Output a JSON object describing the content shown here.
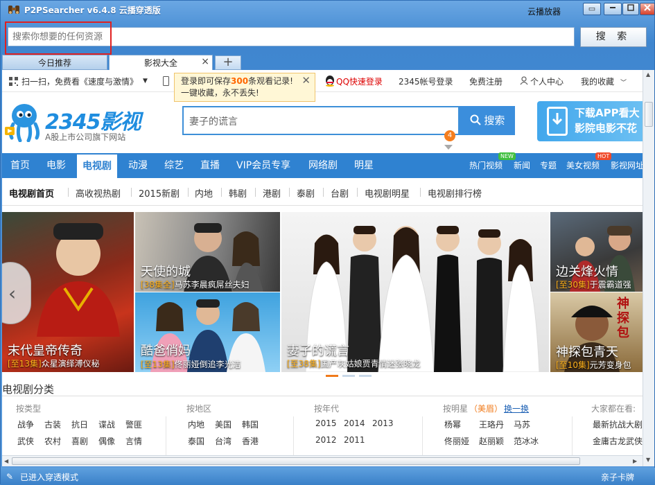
{
  "window": {
    "title": "P2PSearcher v6.4.8 云播穿透版",
    "subtitle": "云播放器",
    "min_label": "▭",
    "restore_label": "—",
    "max_label": "□",
    "close_label": "✕"
  },
  "search": {
    "placeholder": "搜索你想要的任何资源",
    "button_label": "搜 索"
  },
  "tabs": [
    {
      "label": "今日推荐",
      "active": false
    },
    {
      "label": "影视大全",
      "active": true
    }
  ],
  "tab_add_label": "+",
  "toplinks": {
    "scan": "扫一扫，免费看《速度与激情》",
    "qq_login": "QQ快速登录",
    "account_login": "2345帐号登录",
    "register": "免费注册",
    "personal": "个人中心",
    "favorites": "我的收藏"
  },
  "tooltip": {
    "line1_pre": "登录即可保存",
    "line1_num": "300",
    "line1_post": "条观看记录!",
    "line2": "一键收藏，永不丢失!"
  },
  "site": {
    "brand": "2345影视",
    "brand_sub": "A股上市公司旗下网站",
    "search_value": "妻子的谎言",
    "search_badge": "4",
    "search_button": "搜索",
    "app_banner_line1": "下载APP看大",
    "app_banner_line2": "影院电影不花"
  },
  "nav": {
    "items": [
      "首页",
      "电影",
      "电视剧",
      "动漫",
      "综艺",
      "直播",
      "VIP会员专享",
      "网络剧",
      "明星"
    ],
    "active_index": 2,
    "right_items": [
      "热门视频",
      "新闻",
      "专题",
      "美女视频",
      "影视网址"
    ],
    "new_tag": "NEW",
    "hot_tag": "HOT"
  },
  "subnav": [
    "电视剧首页",
    "高收视热剧",
    "2015新剧",
    "内地",
    "韩剧",
    "港剧",
    "泰剧",
    "台剧",
    "电视剧明星",
    "电视剧排行榜"
  ],
  "gallery": [
    {
      "title": "末代皇帝传奇",
      "ep": "[至13集]",
      "desc": "众星演绎溥仪秘"
    },
    {
      "title": "天使的城",
      "ep": "[38集全]",
      "desc": "马苏李晨疯屌丝夫妇"
    },
    {
      "title": "酷爸俏妈",
      "ep": "[至13集]",
      "desc": "佟丽娅倒追李光洁"
    },
    {
      "title": "妻子的谎言",
      "ep": "[至38集]",
      "desc": "国产灰姑娘贾青情迷张晓龙"
    },
    {
      "title": "边关烽火情",
      "ep": "[至30集]",
      "desc": "于震霸道强"
    },
    {
      "title": "神探包青天",
      "ep": "[至10集]",
      "desc": "元芳变身包"
    }
  ],
  "poster_text": "神探包",
  "categories": {
    "title": "电视剧分类",
    "by_type": {
      "header": "按类型",
      "rows": [
        [
          "战争",
          "古装",
          "抗日",
          "谍战",
          "警匪"
        ],
        [
          "武侠",
          "农村",
          "喜剧",
          "偶像",
          "言情"
        ]
      ]
    },
    "by_area": {
      "header": "按地区",
      "rows": [
        [
          "内地",
          "美国",
          "韩国"
        ],
        [
          "泰国",
          "台湾",
          "香港"
        ]
      ]
    },
    "by_year": {
      "header": "按年代",
      "rows": [
        [
          "2015",
          "2014",
          "2013"
        ],
        [
          "2012",
          "2011"
        ]
      ]
    },
    "by_star": {
      "header": "按明星",
      "tag": "（美眉）",
      "switch": "换一换",
      "rows": [
        [
          "杨幂",
          "王珞丹",
          "马苏"
        ],
        [
          "佟丽娅",
          "赵丽颖",
          "范冰冰"
        ]
      ]
    },
    "watching": {
      "header": "大家都在看:",
      "rows": [
        [
          "最新抗战大剧"
        ],
        [
          "金庸古龙武侠"
        ]
      ]
    }
  },
  "status": {
    "text": "已进入穿透模式",
    "right": "亲子卡牌"
  }
}
